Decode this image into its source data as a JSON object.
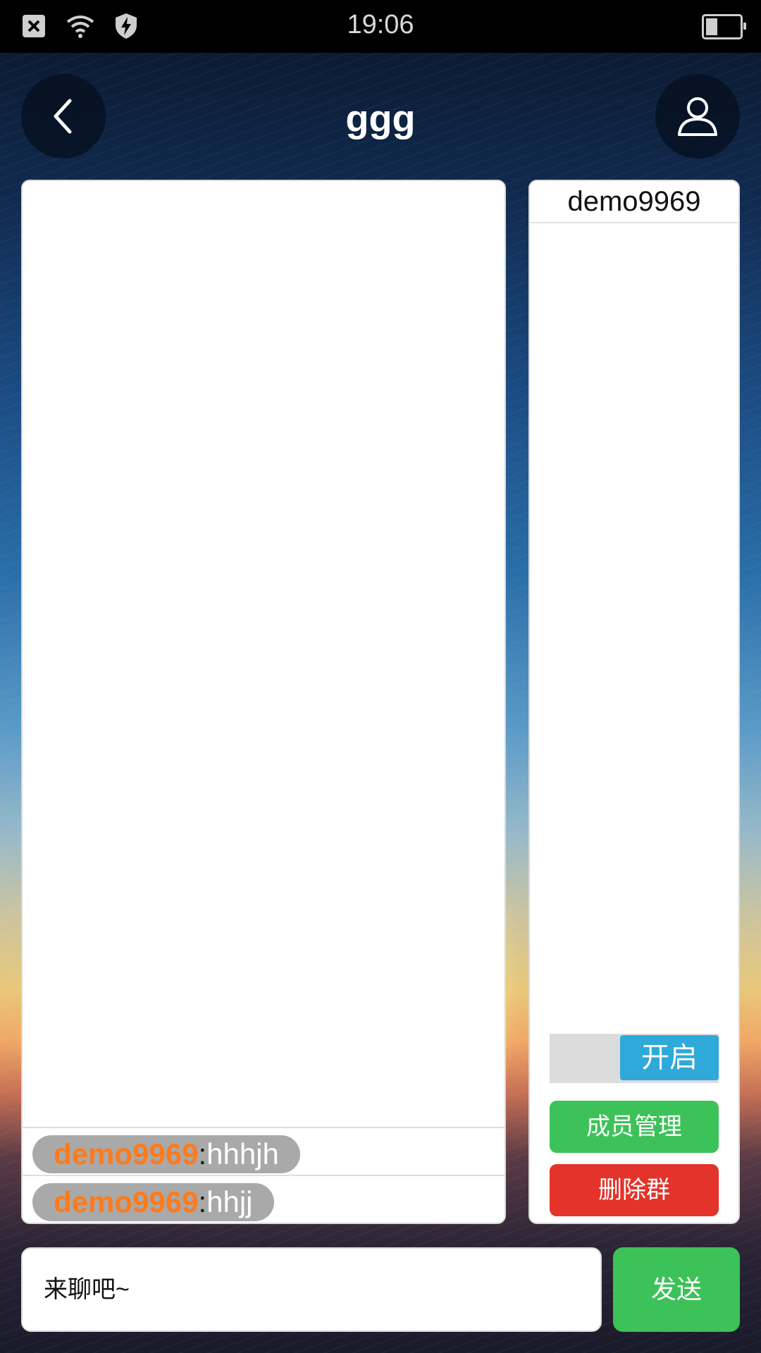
{
  "status_bar": {
    "time": "19:06",
    "icons": [
      "close-box-icon",
      "wifi-icon",
      "shield-bolt-icon",
      "battery-icon"
    ]
  },
  "header": {
    "title": "ggg",
    "back_icon": "chevron-left-icon",
    "profile_icon": "user-icon"
  },
  "chat": {
    "messages": [
      {
        "user": "demo9969",
        "separator": ":",
        "text": "hhhjh"
      },
      {
        "user": "demo9969",
        "separator": ":",
        "text": "hhjj"
      }
    ]
  },
  "members": {
    "list": [
      "demo9969"
    ],
    "toggle_label": "开启",
    "manage_label": "成员管理",
    "delete_label": "删除群"
  },
  "composer": {
    "placeholder": "来聊吧~",
    "send_label": "发送"
  },
  "colors": {
    "username": "#ff7a1a",
    "green": "#3cc259",
    "red": "#e3332a",
    "blue": "#2ea9d9"
  }
}
